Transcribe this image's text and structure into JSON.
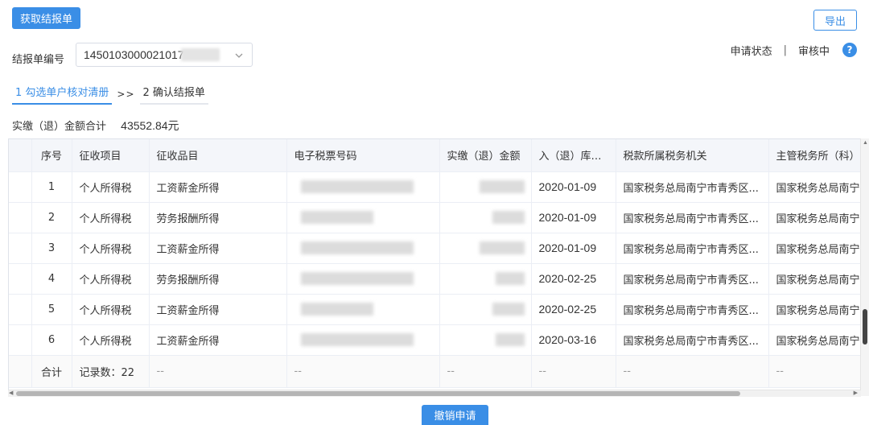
{
  "toolbar": {
    "get_label": "获取结报单",
    "export_label": "导出"
  },
  "report": {
    "label": "结报单编号",
    "number": "1450103000021017"
  },
  "status": {
    "label": "申请状态",
    "separator": "|",
    "value": "审核中",
    "help_icon": "?"
  },
  "steps": {
    "step1": "1 勾选单户核对清册",
    "arrow": ">>",
    "step2": "2 确认结报单"
  },
  "total": {
    "label": "实缴（退）金额合计",
    "amount": "43552.84元"
  },
  "table": {
    "headers": [
      "",
      "序号",
      "征收项目",
      "征收品目",
      "电子税票号码",
      "实缴（退）金额",
      "入（退）库日期",
      "税款所属税务机关",
      "主管税务所（科）"
    ],
    "rows": [
      {
        "seq": "1",
        "item": "个人所得税",
        "category": "工资薪金所得",
        "date": "2020-01-09",
        "org": "国家税务总局南宁市青秀区...",
        "office": "国家税务总局南宁"
      },
      {
        "seq": "2",
        "item": "个人所得税",
        "category": "劳务报酬所得",
        "date": "2020-01-09",
        "org": "国家税务总局南宁市青秀区...",
        "office": "国家税务总局南宁"
      },
      {
        "seq": "3",
        "item": "个人所得税",
        "category": "工资薪金所得",
        "date": "2020-01-09",
        "org": "国家税务总局南宁市青秀区...",
        "office": "国家税务总局南宁"
      },
      {
        "seq": "4",
        "item": "个人所得税",
        "category": "劳务报酬所得",
        "date": "2020-02-25",
        "org": "国家税务总局南宁市青秀区...",
        "office": "国家税务总局南宁"
      },
      {
        "seq": "5",
        "item": "个人所得税",
        "category": "工资薪金所得",
        "date": "2020-02-25",
        "org": "国家税务总局南宁市青秀区...",
        "office": "国家税务总局南宁"
      },
      {
        "seq": "6",
        "item": "个人所得税",
        "category": "工资薪金所得",
        "date": "2020-03-16",
        "org": "国家税务总局南宁市青秀区...",
        "office": "国家税务总局南宁"
      }
    ],
    "footer": {
      "label": "合计",
      "count": "记录数：22",
      "dash": "--"
    }
  },
  "actions": {
    "cancel_label": "撤销申请"
  },
  "colors": {
    "accent": "#3a8ee6",
    "header_bg": "#f4f6fa"
  }
}
